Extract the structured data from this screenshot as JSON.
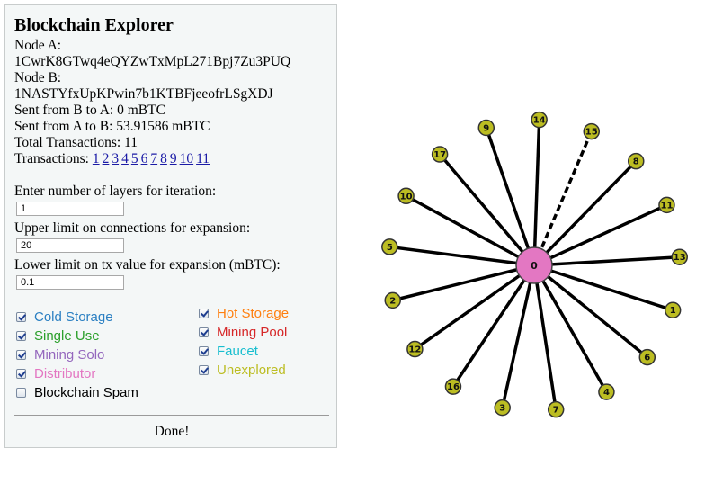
{
  "panel": {
    "title": "Blockchain Explorer",
    "node_a_label": "Node A:",
    "node_a_address": "1CwrK8GTwq4eQYZwTxMpL271Bpj7Zu3PUQ",
    "node_b_label": "Node B:",
    "node_b_address": "1NASTYfxUpKPwin7b1KTBFjeeofrLSgXDJ",
    "sent_b_to_a": "Sent from B to A: 0 mBTC",
    "sent_a_to_b": "Sent from A to B: 53.91586 mBTC",
    "total_transactions": "Total Transactions: 11",
    "transactions_label": "Transactions:",
    "transaction_links": [
      "1",
      "2",
      "3",
      "4",
      "5",
      "6",
      "7",
      "8",
      "9",
      "10",
      "11"
    ],
    "layers_label": "Enter number of layers for iteration:",
    "layers_value": "1",
    "connections_label": "Upper limit on connections for expansion:",
    "connections_value": "20",
    "tx_value_label": "Lower limit on tx value for expansion (mBTC):",
    "tx_value_value": "0.1",
    "done_label": "Done!"
  },
  "filters": {
    "left": [
      {
        "label": "Cold Storage",
        "color": "#2a7fc2",
        "checked": true
      },
      {
        "label": "Single Use",
        "color": "#2ca02c",
        "checked": true
      },
      {
        "label": "Mining Solo",
        "color": "#9467bd",
        "checked": true
      },
      {
        "label": "Distributor",
        "color": "#e377c2",
        "checked": true
      },
      {
        "label": "Blockchain Spam",
        "color": "#000000",
        "checked": false
      }
    ],
    "right": [
      {
        "label": "Hot Storage",
        "color": "#ff7f0e",
        "checked": true
      },
      {
        "label": "Mining Pool",
        "color": "#d62728",
        "checked": true
      },
      {
        "label": "Faucet",
        "color": "#17becf",
        "checked": true
      },
      {
        "label": "Unexplored",
        "color": "#bcbd22",
        "checked": true
      }
    ]
  },
  "graph": {
    "center": {
      "label": "0",
      "color": "#e377c2"
    },
    "node_color": "#bcbd22",
    "edge_color": "#000000",
    "nodes": [
      {
        "label": "14",
        "dashed": false
      },
      {
        "label": "15",
        "dashed": true
      },
      {
        "label": "8",
        "dashed": false
      },
      {
        "label": "11",
        "dashed": false
      },
      {
        "label": "13",
        "dashed": false
      },
      {
        "label": "1",
        "dashed": false
      },
      {
        "label": "6",
        "dashed": false
      },
      {
        "label": "4",
        "dashed": false
      },
      {
        "label": "7",
        "dashed": false
      },
      {
        "label": "3",
        "dashed": false
      },
      {
        "label": "16",
        "dashed": false
      },
      {
        "label": "12",
        "dashed": false
      },
      {
        "label": "2",
        "dashed": false
      },
      {
        "label": "5",
        "dashed": false
      },
      {
        "label": "10",
        "dashed": false
      },
      {
        "label": "17",
        "dashed": false
      },
      {
        "label": "9",
        "dashed": false
      }
    ]
  }
}
